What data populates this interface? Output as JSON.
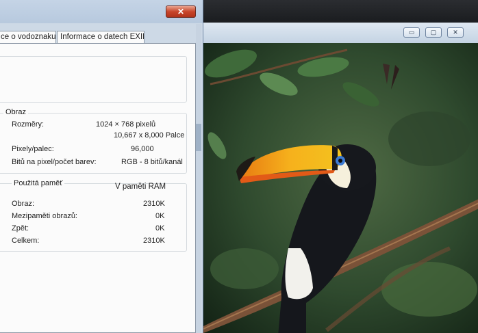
{
  "dialog": {
    "close_glyph": "✕",
    "tabs": [
      {
        "label": "ce o vodoznaku"
      },
      {
        "label": "Informace o datech EXIF"
      }
    ],
    "image_group": {
      "title": "Obraz",
      "dimensions_label": "Rozměry:",
      "dimensions_px": "1024 × 768 pixelů",
      "dimensions_in": "10,667 x 8,000 Palce",
      "ppi_label": "Pixely/palec:",
      "ppi_value": "96,000",
      "bits_label": "Bitů na pixel/počet barev:",
      "bits_value": "RGB - 8 bitů/kanál"
    },
    "memory_group": {
      "title": "Použitá paměť",
      "column_header": "V paměti RAM",
      "rows": [
        {
          "label": "Obraz:",
          "value": "2310K"
        },
        {
          "label": "Mezipaměti obrazů:",
          "value": "0K"
        },
        {
          "label": "Zpět:",
          "value": "0K"
        },
        {
          "label": "Celkem:",
          "value": "2310K"
        }
      ]
    }
  },
  "image_window": {
    "minimize_glyph": "▭",
    "maximize_glyph": "▢",
    "close_glyph": "✕",
    "subject_icon": "toucan-photo-icon"
  },
  "colors": {
    "dialog_bg": "#fbfbfb",
    "frame": "#cdd9e6",
    "close_red": "#c8452a"
  }
}
